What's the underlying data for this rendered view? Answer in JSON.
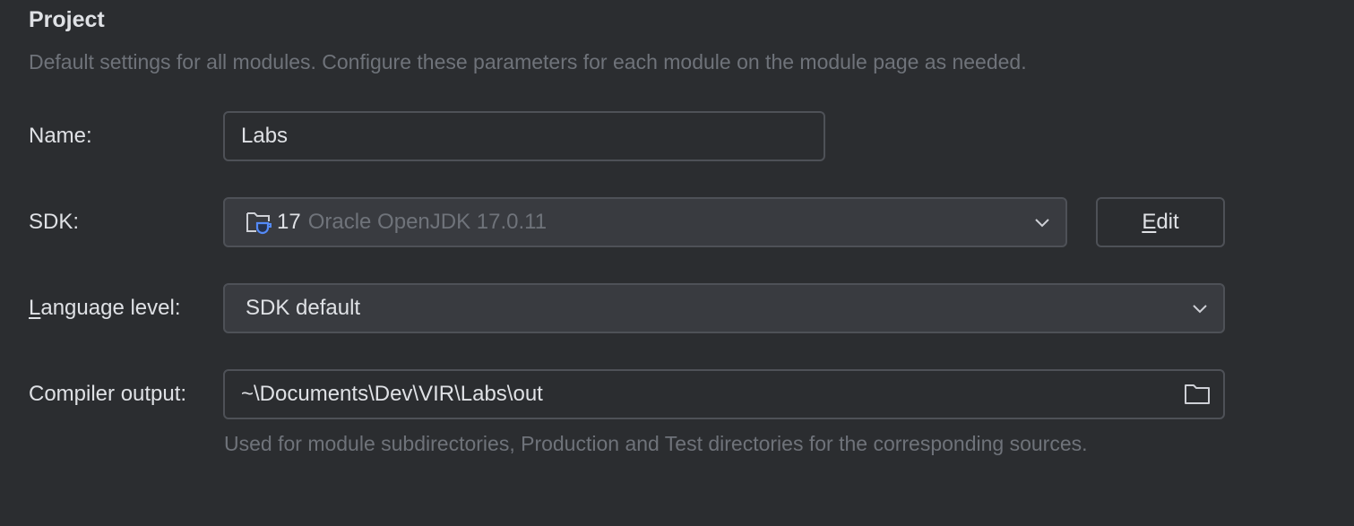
{
  "section": {
    "title": "Project",
    "description": "Default settings for all modules. Configure these parameters for each module on the module page as needed."
  },
  "name": {
    "label": "Name:",
    "value": "Labs"
  },
  "sdk": {
    "label": "SDK:",
    "version": "17",
    "detail": "Oracle OpenJDK 17.0.11",
    "icon": "jdk-folder-icon",
    "edit_mnemonic": "E",
    "edit_rest": "dit"
  },
  "language_level": {
    "label_mnemonic": "L",
    "label_rest": "anguage level:",
    "value": "SDK default"
  },
  "compiler_output": {
    "label": "Compiler output:",
    "value": "~\\Documents\\Dev\\VIR\\Labs\\out",
    "icon": "folder-icon",
    "hint": "Used for module subdirectories, Production and Test directories for the corresponding sources."
  },
  "colors": {
    "background": "#2b2d30",
    "combo": "#393b40",
    "border": "#4e5157",
    "text": "#dfe1e5",
    "muted": "#6f737a",
    "accent": "#548af7"
  }
}
